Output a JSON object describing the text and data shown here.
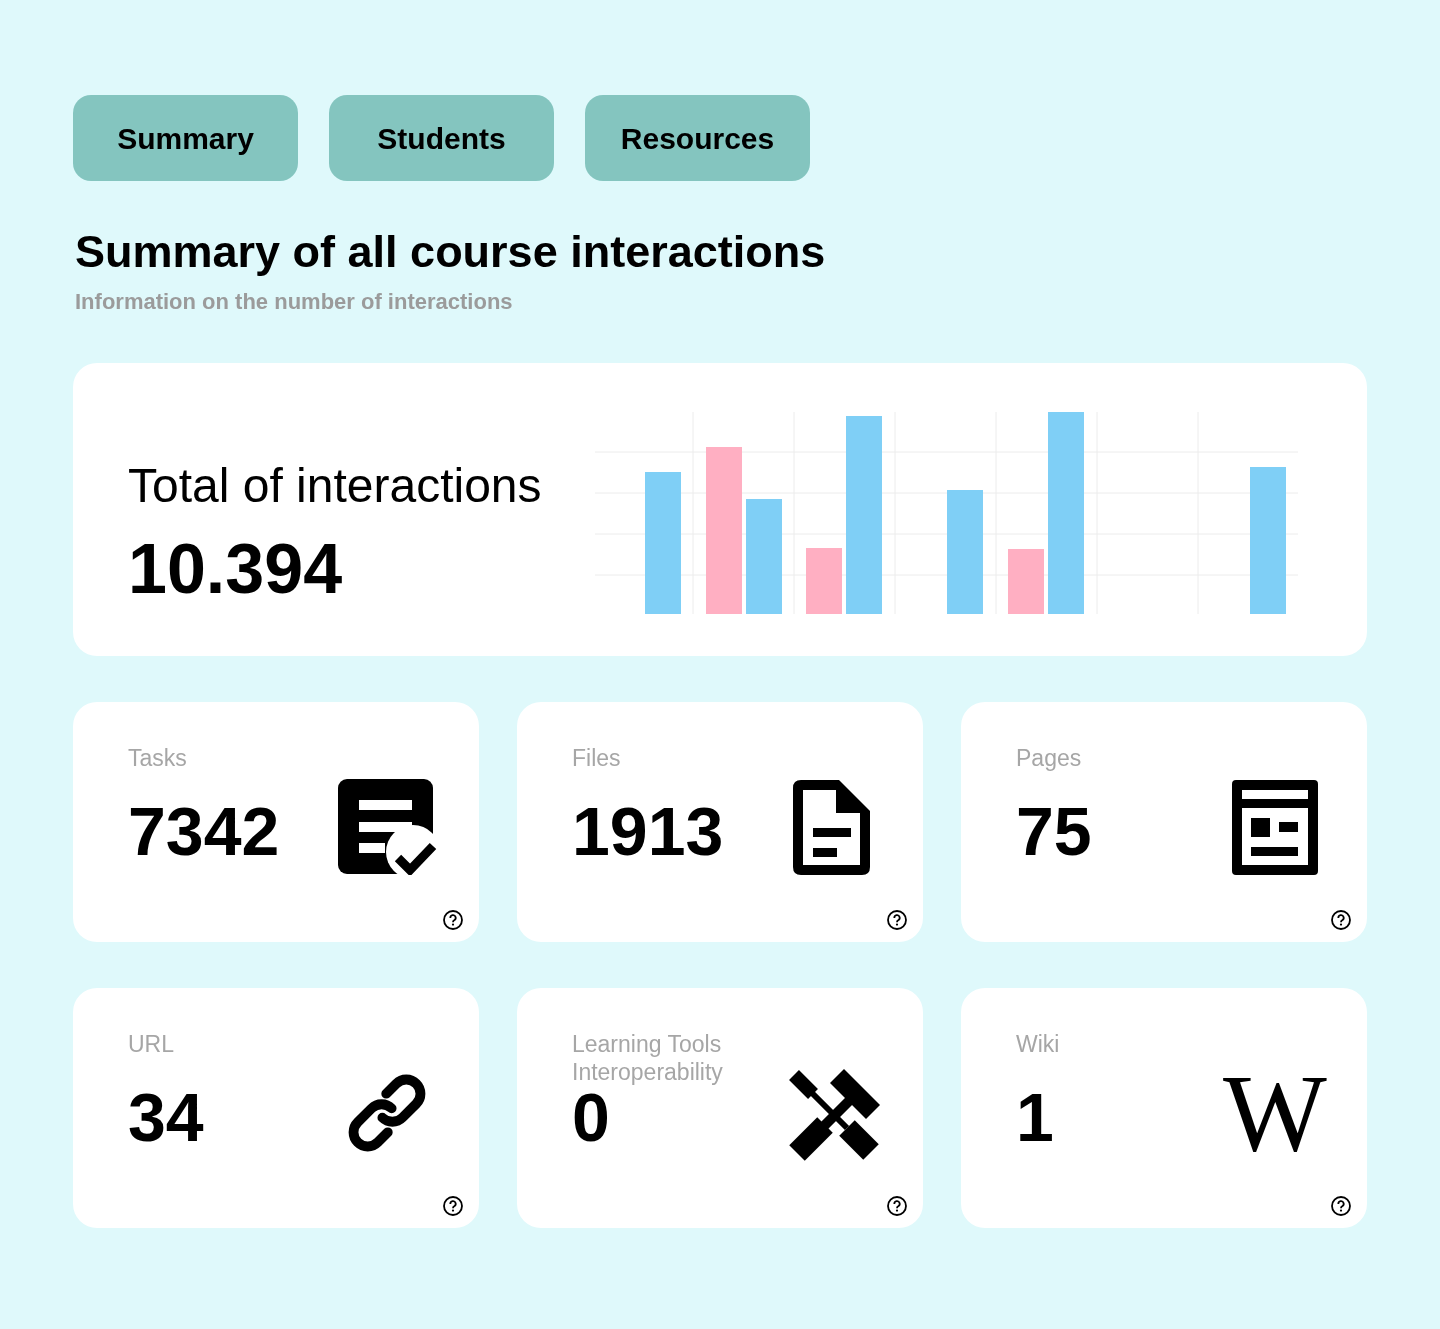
{
  "tabs": [
    {
      "label": "Summary"
    },
    {
      "label": "Students"
    },
    {
      "label": "Resources"
    }
  ],
  "header": {
    "title": "Summary of all course interactions",
    "subtitle": "Information on the number of interactions"
  },
  "total_card": {
    "label": "Total of interactions",
    "value": "10.394"
  },
  "stat_cards": [
    {
      "label": "Tasks",
      "value": "7342"
    },
    {
      "label": "Files",
      "value": "1913"
    },
    {
      "label": "Pages",
      "value": "75"
    },
    {
      "label": "URL",
      "value": "34"
    },
    {
      "label": "Learning Tools Interoperability",
      "value": "0"
    },
    {
      "label": "Wiki",
      "value": "1",
      "glyph": "W"
    }
  ]
}
